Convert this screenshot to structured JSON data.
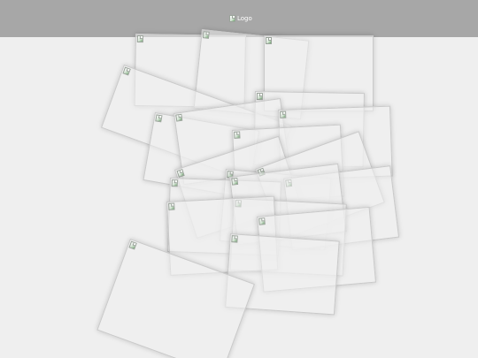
{
  "header": {
    "logo_alt": "Logo"
  },
  "cards": {
    "count": 24,
    "image_icon": "broken-image-icon"
  },
  "colors": {
    "background": "#efefef",
    "topbar": "#a7a7a7",
    "card_border": "#c9c9c9"
  }
}
